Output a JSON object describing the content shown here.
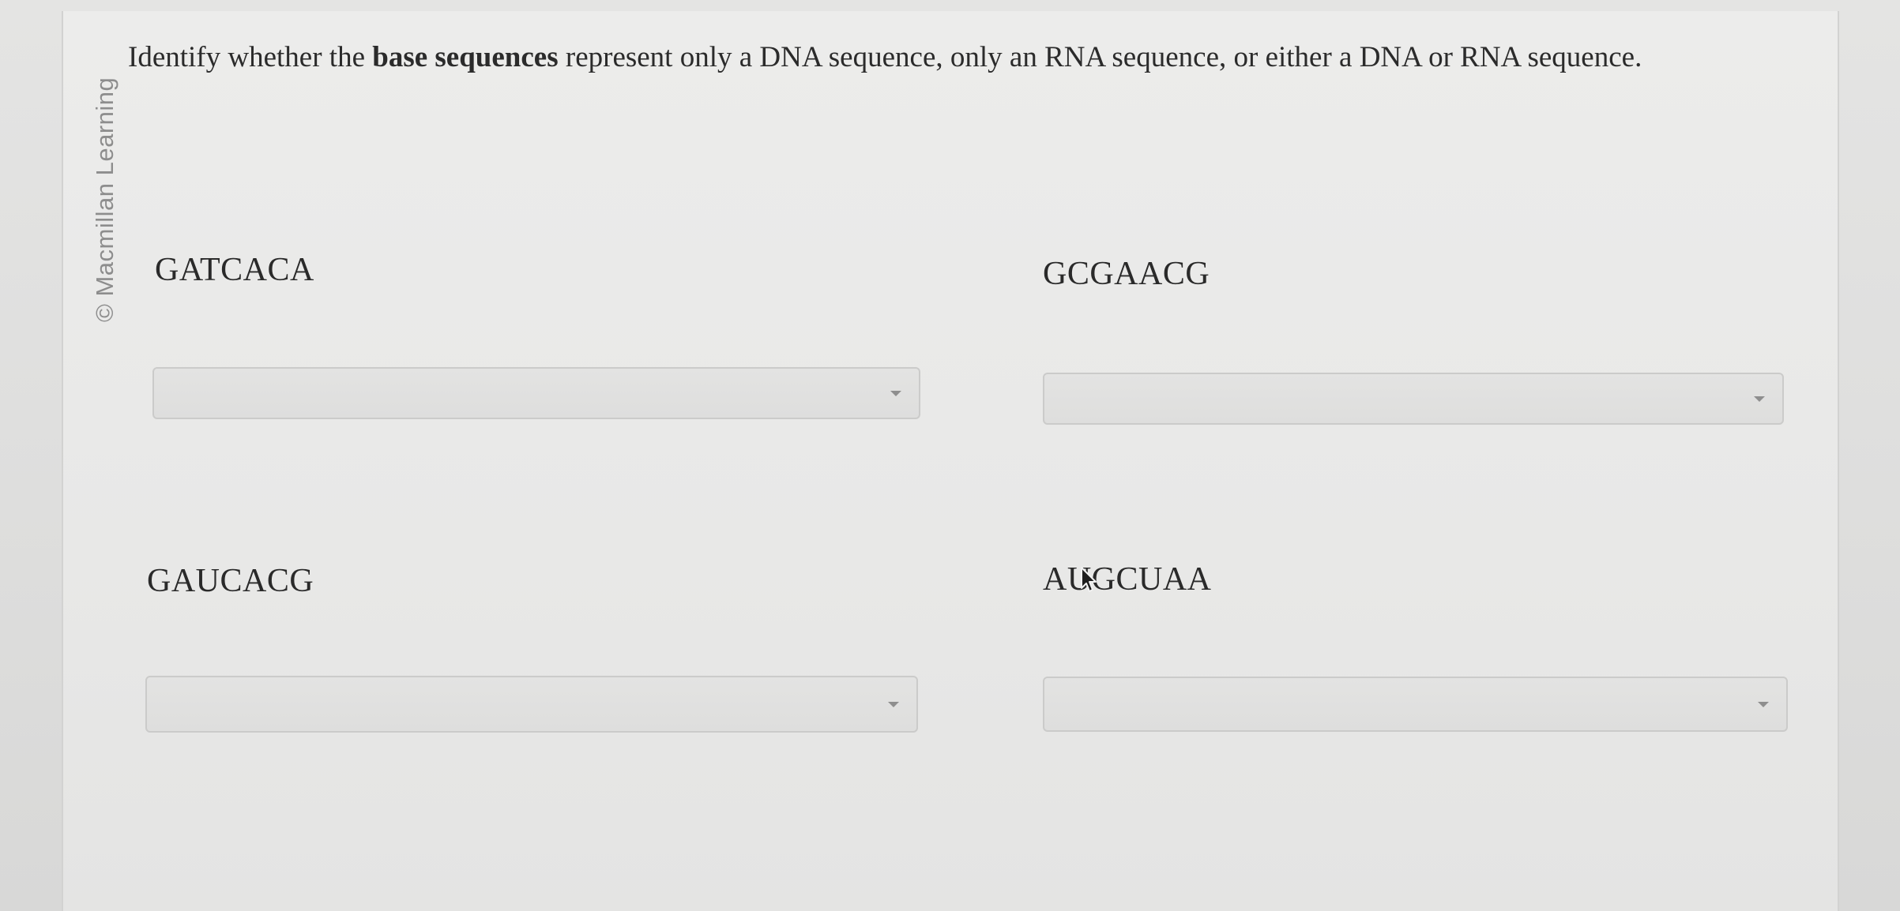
{
  "watermark": "© Macmillan Learning",
  "prompt": {
    "before": "Identify whether the ",
    "bold": "base sequences",
    "after": " represent only a DNA sequence, only an RNA sequence, or either a DNA or RNA sequence."
  },
  "sequences": [
    {
      "label": "GATCACA",
      "selected": ""
    },
    {
      "label": "GCGAACG",
      "selected": ""
    },
    {
      "label": "GAUCACG",
      "selected": ""
    },
    {
      "label": "AUGCUAA",
      "selected": ""
    }
  ],
  "icons": {
    "dropdown_caret": "chevron-down-icon",
    "pointer": "mouse-pointer-icon"
  }
}
